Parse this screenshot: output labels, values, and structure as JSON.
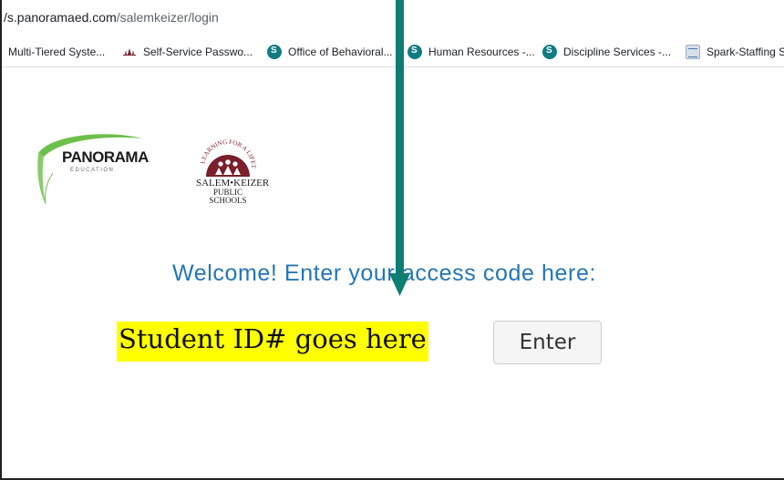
{
  "browser": {
    "url_host": "/s.panoramaed.com",
    "url_path": "/salemkeizer/login"
  },
  "bookmarks": [
    {
      "label": "Multi-Tiered Syste...",
      "icon": "none"
    },
    {
      "label": "Self-Service Passwo...",
      "icon": "skps-icon"
    },
    {
      "label": "Office of Behavioral...",
      "icon": "sharepoint-icon"
    },
    {
      "label": "Human Resources -...",
      "icon": "sharepoint-icon"
    },
    {
      "label": "Discipline Services -...",
      "icon": "sharepoint-icon"
    },
    {
      "label": "Spark-Staffing Sh",
      "icon": "document-icon"
    }
  ],
  "logos": {
    "panorama": {
      "name": "PANORAMA",
      "sub": "EDUCATION"
    },
    "district": {
      "arc_text": "LEARNING FOR A LIFETIME",
      "name": "SALEM•KEIZER",
      "sub": "PUBLIC SCHOOLS"
    }
  },
  "login": {
    "welcome": "Welcome! Enter your access code here:",
    "code_value": "Student ID# goes here",
    "enter_label": "Enter"
  },
  "colors": {
    "welcome_text": "#2476b5",
    "highlight": "#ffff00",
    "arrow": "#0f7d74",
    "district_maroon": "#7a1f2b"
  }
}
